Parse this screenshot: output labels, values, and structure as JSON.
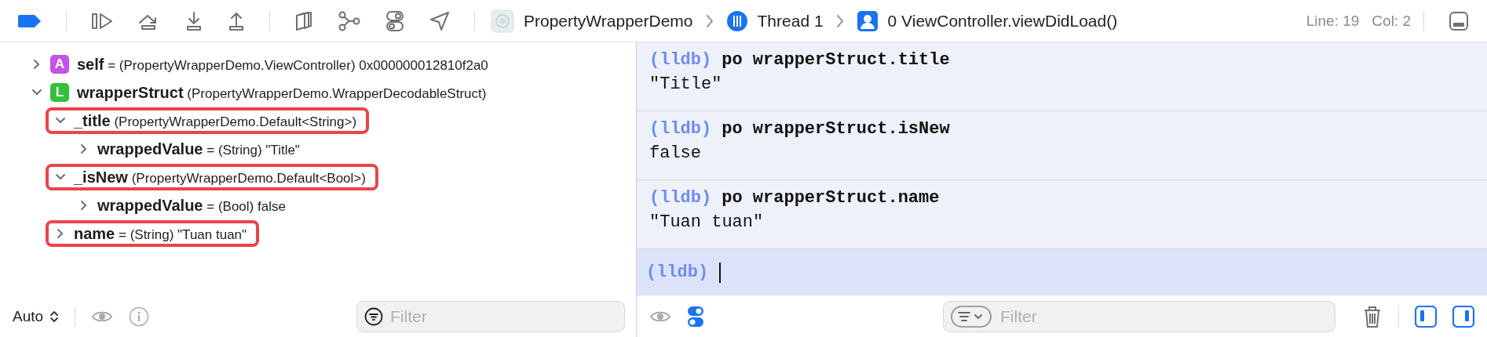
{
  "toolbar": {
    "breadcrumbs": [
      {
        "kind": "app",
        "label": "PropertyWrapperDemo"
      },
      {
        "kind": "thread",
        "label": "Thread 1"
      },
      {
        "kind": "frame",
        "label": "0 ViewController.viewDidLoad()"
      }
    ],
    "line": "Line: 19",
    "col": "Col: 2"
  },
  "variables": {
    "items": [
      {
        "name": "self",
        "badge": "A",
        "color": "#c454e6",
        "detail": "= (PropertyWrapperDemo.ViewController) 0x000000012810f2a0",
        "expanded": false,
        "highlighted": false
      },
      {
        "name": "wrapperStruct",
        "badge": "L",
        "color": "#34c03a",
        "detail": "(PropertyWrapperDemo.WrapperDecodableStruct)",
        "expanded": true,
        "highlighted": false,
        "children": [
          {
            "name": "_title",
            "detail": "(PropertyWrapperDemo.Default<String>)",
            "expanded": true,
            "highlighted": true,
            "children": [
              {
                "name": "wrappedValue",
                "detail": "= (String) \"Title\"",
                "expanded": false,
                "highlighted": false
              }
            ]
          },
          {
            "name": "_isNew",
            "detail": "(PropertyWrapperDemo.Default<Bool>)",
            "expanded": true,
            "highlighted": true,
            "children": [
              {
                "name": "wrappedValue",
                "detail": "= (Bool) false",
                "expanded": false,
                "highlighted": false
              }
            ]
          },
          {
            "name": "name",
            "detail": "= (String) \"Tuan tuan\"",
            "expanded": false,
            "highlighted": true
          }
        ]
      }
    ]
  },
  "variables_footer": {
    "mode": "Auto",
    "filter": {
      "placeholder": "Filter"
    }
  },
  "console": {
    "entries": [
      {
        "prompt": "(lldb)",
        "command": "po wrapperStruct.title",
        "output": "\"Title\""
      },
      {
        "prompt": "(lldb)",
        "command": "po wrapperStruct.isNew",
        "output": "false"
      },
      {
        "prompt": "(lldb)",
        "command": "po wrapperStruct.name",
        "output": "\"Tuan tuan\""
      }
    ],
    "input": {
      "prompt": "(lldb)"
    }
  },
  "console_footer": {
    "filter": {
      "placeholder": "Filter"
    }
  }
}
